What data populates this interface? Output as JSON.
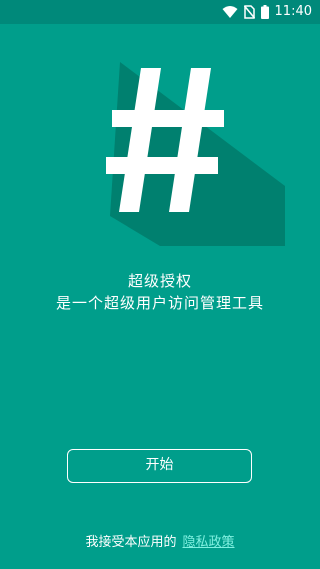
{
  "status_bar": {
    "time": "11:40",
    "icons": [
      "wifi-icon",
      "no-sim-icon",
      "battery-icon"
    ]
  },
  "hero": {
    "logo_symbol": "#"
  },
  "headline": {
    "title": "超级授权",
    "subtitle": "是一个超级用户访问管理工具"
  },
  "actions": {
    "start_label": "开始"
  },
  "footer": {
    "consent_text": "我接受本应用的",
    "privacy_link": "隐私政策"
  },
  "colors": {
    "background": "#009E8B",
    "status_bar": "#00897A",
    "link": "#7FF0E0"
  }
}
